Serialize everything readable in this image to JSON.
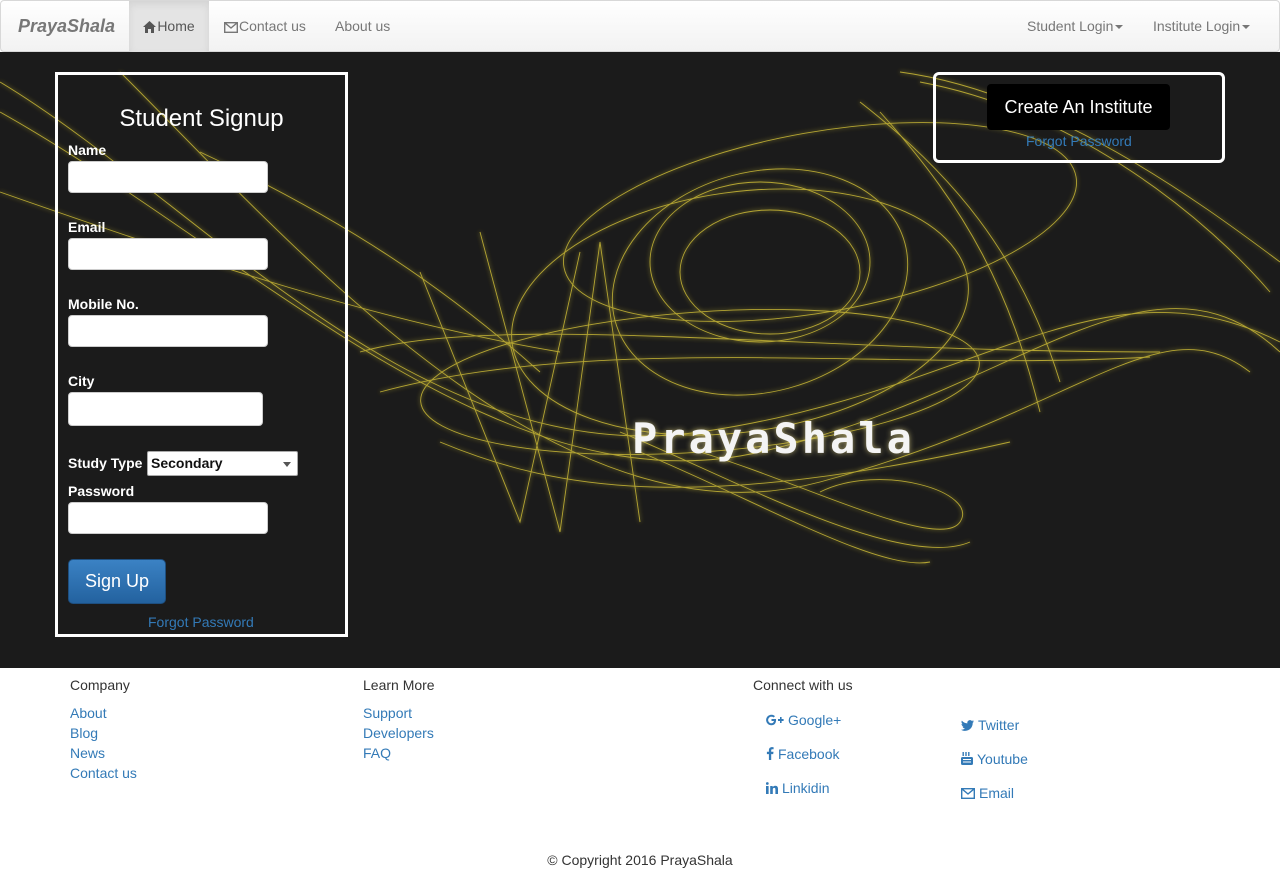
{
  "navbar": {
    "brand": "PrayaShala",
    "items": [
      {
        "label": "Home",
        "icon": "home-icon"
      },
      {
        "label": "Contact us",
        "icon": "envelope-icon"
      },
      {
        "label": "About us"
      }
    ],
    "right_items": [
      {
        "label": "Student Login"
      },
      {
        "label": "Institute Login"
      }
    ]
  },
  "hero": {
    "title": "PrayaShala",
    "colors": {
      "background": "#1b1b1b",
      "art": "#e8d43a"
    }
  },
  "signup": {
    "title": "Student Signup",
    "name_label": "Name",
    "name_value": "",
    "email_label": "Email",
    "email_value": "",
    "mobile_label": "Mobile No.",
    "mobile_value": "",
    "city_label": "City",
    "city_value": "",
    "study_type_label": "Study Type",
    "study_type_selected": "Secondary",
    "password_label": "Password",
    "password_value": "",
    "submit_label": "Sign Up",
    "forgot_label": "Forgot Password"
  },
  "institute": {
    "create_label": "Create An Institute",
    "forgot_label": "Forgot Password"
  },
  "footer": {
    "company": {
      "heading": "Company",
      "links": [
        "About",
        "Blog",
        "News",
        "Contact us"
      ]
    },
    "learn": {
      "heading": "Learn More",
      "links": [
        "Support",
        "Developers",
        "FAQ"
      ]
    },
    "connect": {
      "heading": "Connect with us",
      "left": [
        {
          "label": "Google+",
          "icon": "google-plus-icon"
        },
        {
          "label": "Facebook",
          "icon": "facebook-icon"
        },
        {
          "label": "Linkidin",
          "icon": "linkedin-icon"
        }
      ],
      "right": [
        {
          "label": "Twitter",
          "icon": "twitter-icon"
        },
        {
          "label": "Youtube",
          "icon": "youtube-icon"
        },
        {
          "label": "Email",
          "icon": "envelope-icon"
        }
      ]
    },
    "copyright": "© Copyright 2016 PrayaShala"
  },
  "colors": {
    "link": "#337ab7",
    "primary_button": "#286090"
  }
}
